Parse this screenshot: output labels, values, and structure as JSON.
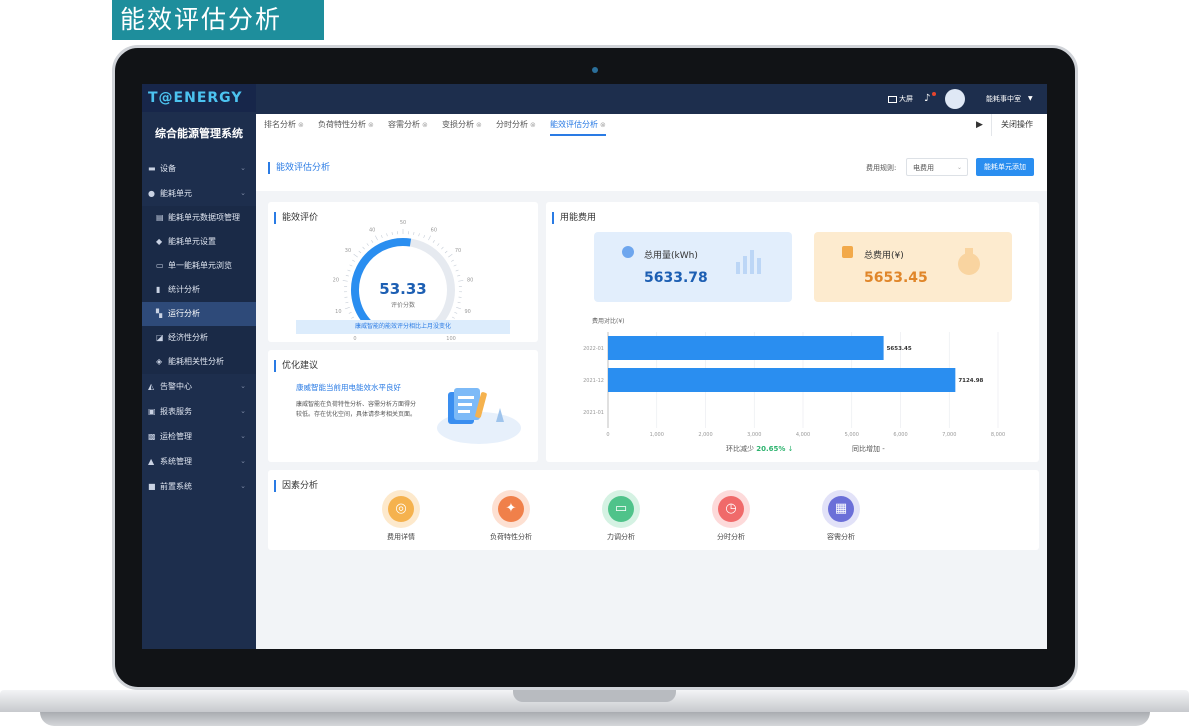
{
  "banner": {
    "title": "能效评估分析"
  },
  "app": {
    "logo": "T@ENERGY",
    "system_title": "综合能源管理系统"
  },
  "topbar": {
    "screen_label": "大屏",
    "user_name": "能耗事中室"
  },
  "sidebar": {
    "items": [
      {
        "label": "设备",
        "icon": "server-icon",
        "level": 1
      },
      {
        "label": "能耗单元",
        "icon": "dot-icon",
        "level": 1
      },
      {
        "label": "能耗单元数据项管理",
        "icon": "list-icon",
        "level": 2
      },
      {
        "label": "能耗单元设置",
        "icon": "settings-icon",
        "level": 2
      },
      {
        "label": "单一能耗单元浏览",
        "icon": "browse-icon",
        "level": 2
      },
      {
        "label": "统计分析",
        "icon": "stats-icon",
        "level": 2
      },
      {
        "label": "运行分析",
        "icon": "run-icon",
        "level": 2,
        "active": true
      },
      {
        "label": "经济性分析",
        "icon": "economy-icon",
        "level": 2
      },
      {
        "label": "能耗相关性分析",
        "icon": "shield-icon",
        "level": 2
      },
      {
        "label": "告警中心",
        "icon": "bell-icon",
        "level": 1
      },
      {
        "label": "报表服务",
        "icon": "report-icon",
        "level": 1
      },
      {
        "label": "运检管理",
        "icon": "tool-icon",
        "level": 1
      },
      {
        "label": "系统管理",
        "icon": "lock-icon",
        "level": 1
      },
      {
        "label": "前置系统",
        "icon": "front-icon",
        "level": 1
      }
    ]
  },
  "tabs": {
    "items": [
      {
        "label": "排名分析"
      },
      {
        "label": "负荷特性分析"
      },
      {
        "label": "容需分析"
      },
      {
        "label": "变损分析"
      },
      {
        "label": "分时分析"
      },
      {
        "label": "能效评估分析",
        "active": true
      }
    ],
    "close_ops": "关闭操作"
  },
  "page": {
    "title": "能效评估分析",
    "fee_rule_label": "费用规则:",
    "fee_rule_value": "电费用",
    "unit_button": "能耗单元添加"
  },
  "eval": {
    "title": "能效评价",
    "score": "53.33",
    "score_label": "评价分数",
    "gauge_ticks": [
      "0",
      "10",
      "20",
      "30",
      "40",
      "50",
      "60",
      "70",
      "80",
      "90",
      "100"
    ],
    "note": "康威智能的能效评分相比上月没变化",
    "score_value": 53.33
  },
  "advice": {
    "title": "优化建议",
    "headline": "康威智能当前用电能效水平良好",
    "body": "康威智能在负荷特性分析、容需分析方面得分较低。存在优化空间，具体请参考相关页面。"
  },
  "cost": {
    "title": "用能费用",
    "total_usage_label": "总用量(kWh)",
    "total_usage_value": "5633.78",
    "total_cost_label": "总费用(¥)",
    "total_cost_value": "5653.45",
    "chart_label": "费用对比(¥)",
    "mom_label": "环比减少",
    "mom_value": "20.65%",
    "yoy_label": "同比增加",
    "yoy_value": "-"
  },
  "chart_data": {
    "type": "bar",
    "orientation": "horizontal",
    "title": "费用对比(¥)",
    "categories": [
      "2022-01",
      "2021-12",
      "2021-01"
    ],
    "values": [
      5653.45,
      7124.98,
      0
    ],
    "data_labels": [
      "5653.45",
      "7124.98",
      ""
    ],
    "xlim": [
      0,
      8000
    ],
    "x_ticks": [
      "0",
      "1,000",
      "2,000",
      "3,000",
      "4,000",
      "5,000",
      "6,000",
      "7,000",
      "8,000"
    ],
    "grid": true,
    "bar_color": "#2a8ef0"
  },
  "factor": {
    "title": "因素分析",
    "items": [
      {
        "label": "费用详情",
        "icon": "coins-icon",
        "color": "#f5b24e",
        "bg": "#fde9cc"
      },
      {
        "label": "负荷特性分析",
        "icon": "bolt-icon",
        "color": "#f0804a",
        "bg": "#fde0d2"
      },
      {
        "label": "力调分析",
        "icon": "meter-icon",
        "color": "#4fc38a",
        "bg": "#d5f2e3"
      },
      {
        "label": "分时分析",
        "icon": "clock-icon",
        "color": "#f06a6a",
        "bg": "#fddada"
      },
      {
        "label": "容需分析",
        "icon": "grid-icon",
        "color": "#6b6fd8",
        "bg": "#e2e2f8"
      }
    ]
  }
}
